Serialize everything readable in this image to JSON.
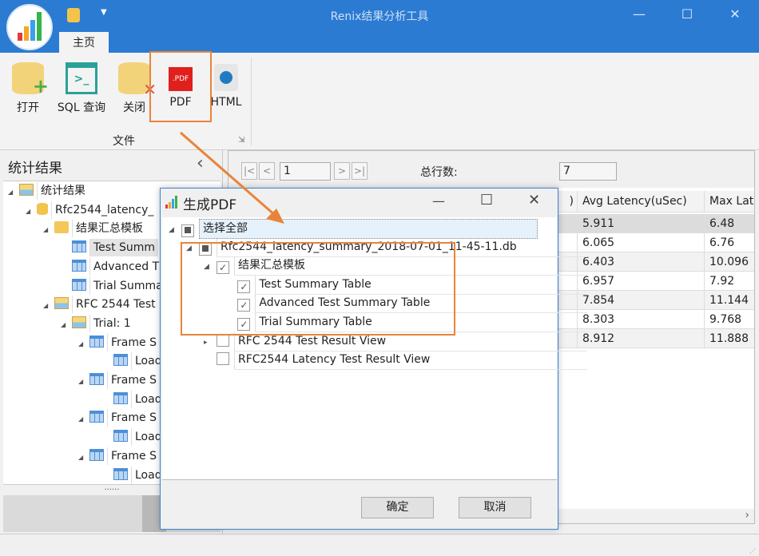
{
  "window": {
    "title": "Renix结果分析工具",
    "minimize": "—",
    "maximize": "☐",
    "close": "✕"
  },
  "ribbon": {
    "tab": "主页",
    "buttons": [
      {
        "label": "打开",
        "icon": "database-add-icon"
      },
      {
        "label": "SQL 查询",
        "icon": "terminal-icon"
      },
      {
        "label": "关闭",
        "icon": "database-close-icon"
      },
      {
        "label": "PDF",
        "icon": "pdf-icon"
      },
      {
        "label": "HTML",
        "icon": "globe-icon"
      }
    ],
    "pdf_badge": ".PDF",
    "group": "文件"
  },
  "left_panel": {
    "title": "统计结果",
    "collapse": "‹",
    "tree": [
      {
        "label": "统计结果",
        "level": 0,
        "icon": "image"
      },
      {
        "label": "Rfc2544_latency_",
        "level": 1,
        "icon": "db"
      },
      {
        "label": "结果汇总模板",
        "level": 2,
        "icon": "folder"
      },
      {
        "label": "Test Summ",
        "level": 3,
        "icon": "table",
        "selected": true
      },
      {
        "label": "Advanced T",
        "level": 3,
        "icon": "table"
      },
      {
        "label": "Trial Summa",
        "level": 3,
        "icon": "table"
      },
      {
        "label": "RFC 2544 Test",
        "level": 2,
        "icon": "image"
      },
      {
        "label": "Trial: 1",
        "level": 3,
        "icon": "image"
      },
      {
        "label": "Frame S",
        "level": 4,
        "icon": "table"
      },
      {
        "label": "Load",
        "level": 5,
        "icon": "table"
      },
      {
        "label": "Frame S",
        "level": 4,
        "icon": "table"
      },
      {
        "label": "Load",
        "level": 5,
        "icon": "table"
      },
      {
        "label": "Frame S",
        "level": 4,
        "icon": "table"
      },
      {
        "label": "Load",
        "level": 5,
        "icon": "table"
      },
      {
        "label": "Frame S",
        "level": 4,
        "icon": "table"
      },
      {
        "label": "Load",
        "level": 5,
        "icon": "table"
      }
    ],
    "splitter": "......"
  },
  "pager": {
    "first": "|<",
    "prev": "<",
    "page": "1",
    "next": ">",
    "last": ">|",
    "total_label": "总行数:",
    "total": "7"
  },
  "grid": {
    "columns": [
      ")",
      "Avg Latency(uSec)",
      "Max Lat"
    ],
    "rows": [
      [
        "",
        "5.911",
        "6.48"
      ],
      [
        "",
        "6.065",
        "6.76"
      ],
      [
        "",
        "6.403",
        "10.096"
      ],
      [
        "",
        "6.957",
        "7.92"
      ],
      [
        "",
        "7.854",
        "11.144"
      ],
      [
        "",
        "8.303",
        "9.768"
      ],
      [
        "",
        "8.912",
        "11.888"
      ]
    ],
    "scroll_right": "›"
  },
  "dialog": {
    "title": "生成PDF",
    "minimize": "—",
    "maximize": "☐",
    "close": "✕",
    "tree": [
      {
        "label": "选择全部",
        "level": 0,
        "state": "partial",
        "expander": "open"
      },
      {
        "label": "Rfc2544_latency_summary_2018-07-01_11-45-11.db",
        "level": 1,
        "state": "partial",
        "expander": "open"
      },
      {
        "label": "结果汇总模板",
        "level": 2,
        "state": "checked",
        "expander": "open"
      },
      {
        "label": "Test Summary Table",
        "level": 3,
        "state": "checked"
      },
      {
        "label": "Advanced Test Summary Table",
        "level": 3,
        "state": "checked"
      },
      {
        "label": "Trial Summary Table",
        "level": 3,
        "state": "checked"
      },
      {
        "label": "RFC 2544 Test Result View",
        "level": 2,
        "state": "unchecked",
        "expander": "closed"
      },
      {
        "label": "RFC2544 Latency Test Result View",
        "level": 2,
        "state": "unchecked"
      }
    ],
    "ok": "确定",
    "cancel": "取消"
  },
  "colors": {
    "titlebar": "#2b7bd3",
    "annotation": "#e8843a",
    "dialog_border": "#3b86d4"
  }
}
